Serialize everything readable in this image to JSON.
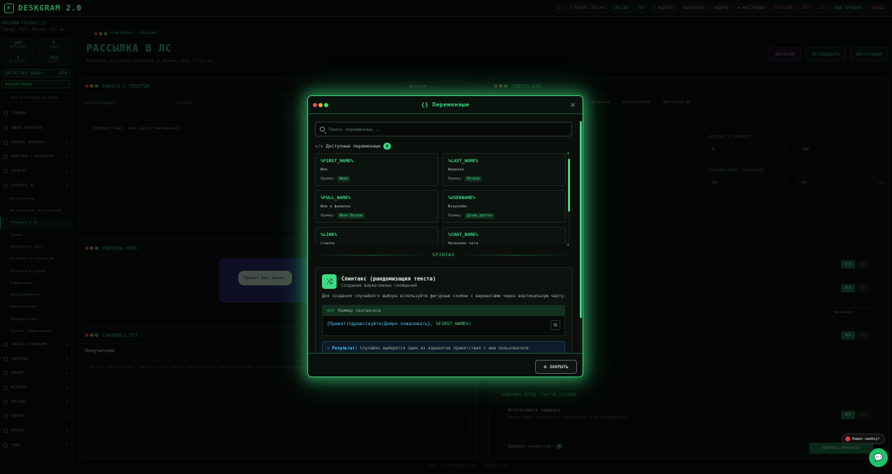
{
  "topbar": {
    "logo": "DESKGRAM 2.0",
    "search": "ПОИСК",
    "search_kbd": "CTRL+K",
    "online": "ONLINE",
    "count": "99",
    "alerts": "ALERTS",
    "accounts": "АККАУНТЫ",
    "tasks": "ЗАДАЧИ",
    "settings": "НАСТРОЙКИ",
    "language": "РУССКИЙ",
    "off": "OFF",
    "r1": "15",
    "user": "ВАШ ПРОФИЛЬ",
    "exit": "ВЫХОД"
  },
  "sidebar": {
    "account": "DEKGRAM TGCHNCL.II",
    "account_sub": "Тариф: Full Access",
    "account_days": "465 дн",
    "stats": [
      {
        "value": "1023",
        "label": "АКТИВНЫХ"
      },
      {
        "value": "0",
        "label": "ЗАДАЧ"
      },
      {
        "value": "0",
        "label": "В РАБОТЕ"
      },
      {
        "value": "1023",
        "label": "ВСЕГО"
      }
    ],
    "dispatcher": "ДИСПЕТЧЕР ЗАДАЧ",
    "dispatcher_badge": "NEW",
    "planner": "ПЛАНИРОВЩИК",
    "search_placeholder": "Найти модуль в меню",
    "nav": [
      {
        "label": "Главная",
        "arrow": ""
      },
      {
        "label": "Выбор аккаунтов",
        "arrow": ""
      },
      {
        "label": "Перенос аккаунта",
        "arrow": "▾"
      },
      {
        "label": "Действия с аккаунтом",
        "arrow": "▾"
      },
      {
        "label": "Регистр",
        "arrow": "▾"
      },
      {
        "label": "Отправка ЛС",
        "arrow": "▴"
      }
    ],
    "subnav": [
      "Автоответчик",
      "Автоответчик автоответчик",
      "Рассылка в ЛС",
      "Звонки",
      "Публиковать фото",
      "Рассылка по контактам",
      "Рассылка в группы",
      "Комментарии",
      "Нейрокомментинг",
      "Нейроответчик",
      "Нейрорассылка",
      "Парсинг комментариев"
    ],
    "subnav_active_index": 2,
    "nav2": [
      "Работа с каналами",
      "Накрутка",
      "Инвайт",
      "История",
      "Персоны",
      "Чекеры",
      "Прокси",
      "Темы"
    ]
  },
  "page": {
    "chip": "SPAM MODULE · DESKGRAM",
    "title": "РАССЫЛКА В ЛС",
    "subtitle": "Массовая рассылка сообщений в личные чаты Telegram",
    "btn_history": "ОБУЧЕНИЕ",
    "btn_research": "ИССЛЕДОВАТЬ",
    "btn_manual": "ИНСТРУКЦИЯ",
    "texts_panel": "РАБОТА С ТЕКСТОМ",
    "texts_template": "Шаблон ...",
    "format_label": "ФОРМАТИРОВАНИЕ:",
    "insert_label": "ВСТАВКА:",
    "message_text": "{Привет|Хай}, как {дела|сам|жизнь}?",
    "preview_panel": "PREVIEW.HTML",
    "preview_bubble": "Привет Как жизнь?",
    "recipients_panel": "CHANNELS.TXT",
    "recipients_title": "Получатели",
    "recipients_placeholder": "Введите имена юзеров — каждый с новой строки. После отправки сообщения контакт автоматически удаляется",
    "config_panel": "CONFIG.EXE",
    "tab_schedule": "Отправка",
    "tab_auto": "Автоответчик",
    "tab_settings": "Настройки ЛС",
    "delay_label": "ЗАДЕРЖКА ПО АККАУНТУ",
    "delay_from": "0",
    "delay_to": "100",
    "limit_label": "ЗАДЕРЖКА МЕЖДУ СООБЩЕНИЯМИ",
    "limit_from": "50",
    "limit_to": "60",
    "limit_unit": "Сек",
    "on": "ВКЛ",
    "off": "ВЫ",
    "select_value": "Выполнено",
    "delay_section": "ЗАДЕРЖКА ПЕРЕД СТАРТОМ ПОТОКОВ",
    "use_delay": "Использовать задержку",
    "use_delay_sub": "Потоки будут запускаться с интервалом, а не одновременно",
    "selected_accounts": "Выбрано аккаунтов:",
    "selected_count": "0",
    "select_accounts_btn": "ВЫБРАТЬ АККАУНТЫ",
    "footer": "СТАРТ ПО ОТКРЫТЫМ ЧАТАМ · ОЧЕРЕДЬ ЗАДАЧ"
  },
  "modal": {
    "title": "{} Переменные",
    "search_placeholder": "Поиск переменных...",
    "available_label": "Доступные переменные",
    "available_count": "8",
    "example_label": "Пример:",
    "variables": [
      {
        "name": "%FIRST_NAME%",
        "desc": "Имя",
        "example": "Иван"
      },
      {
        "name": "%LAST_NAME%",
        "desc": "Фамилия",
        "example": "Петров"
      },
      {
        "name": "%FULL_NAME%",
        "desc": "Имя и фамилия",
        "example": "Иван Петров"
      },
      {
        "name": "%USERNAME%",
        "desc": "Юзернейм",
        "example": "@ivan_petrov"
      },
      {
        "name": "%LINK%",
        "desc": "Ссылка",
        "example": ""
      },
      {
        "name": "%CHAT_NAME%",
        "desc": "Название чата",
        "example": ""
      }
    ],
    "spintax_label": "SPINTAX",
    "spintax_title": "Спинтакс (рандомизация текста)",
    "spintax_subtitle": "Создание вариативных сообщений",
    "spintax_desc": "Для создания случайного выбора используйте фигурные скобки с вариантами через вертикальную черту:",
    "syntax_header": "Пример синтаксиса",
    "syntax_code": "{Привет|Здравствуйте|Добро пожаловать},",
    "syntax_var": "%FIRST_NAME%!",
    "result_label": "Результат:",
    "result_text": "Случайно выберется один из вариантов приветствия + имя пользователя",
    "close_label": "ЗАКРЫТЬ"
  },
  "widgets": {
    "help": "Нашёл ошибку?"
  },
  "colors": {
    "accent": "#3ddc84",
    "background": "#050806",
    "danger": "#e05252",
    "info": "#49c7ff"
  }
}
